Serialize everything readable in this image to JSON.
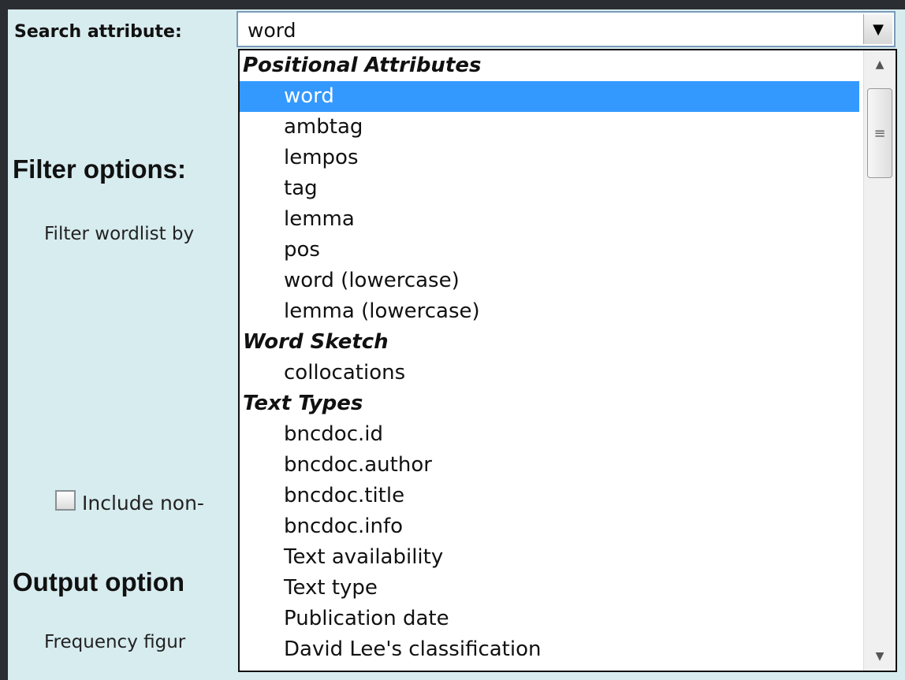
{
  "form": {
    "search_attribute_label": "Search attribute:",
    "filter_heading": "Filter options:",
    "filter_wordlist_label": "Filter wordlist by",
    "include_label": "Include non-",
    "output_heading": "Output option",
    "frequency_label": "Frequency figur"
  },
  "select": {
    "value": "word",
    "groups": [
      {
        "label": "Positional Attributes",
        "options": [
          "word",
          "ambtag",
          "lempos",
          "tag",
          "lemma",
          "pos",
          "word (lowercase)",
          "lemma (lowercase)"
        ]
      },
      {
        "label": "Word Sketch",
        "options": [
          "collocations"
        ]
      },
      {
        "label": "Text Types",
        "options": [
          "bncdoc.id",
          "bncdoc.author",
          "bncdoc.title",
          "bncdoc.info",
          "Text availability",
          "Text type",
          "Publication date",
          "David Lee's classification"
        ]
      }
    ],
    "selected_option": "word"
  },
  "icons": {
    "dropdown_arrow": "chevron-down-icon",
    "scroll_up": "scroll-up-icon",
    "scroll_down": "scroll-down-icon",
    "checkbox": "checkbox-icon"
  },
  "colors": {
    "page_bg": "#d7ecef",
    "selected_bg": "#3399ff",
    "frame": "#2a2d31"
  }
}
